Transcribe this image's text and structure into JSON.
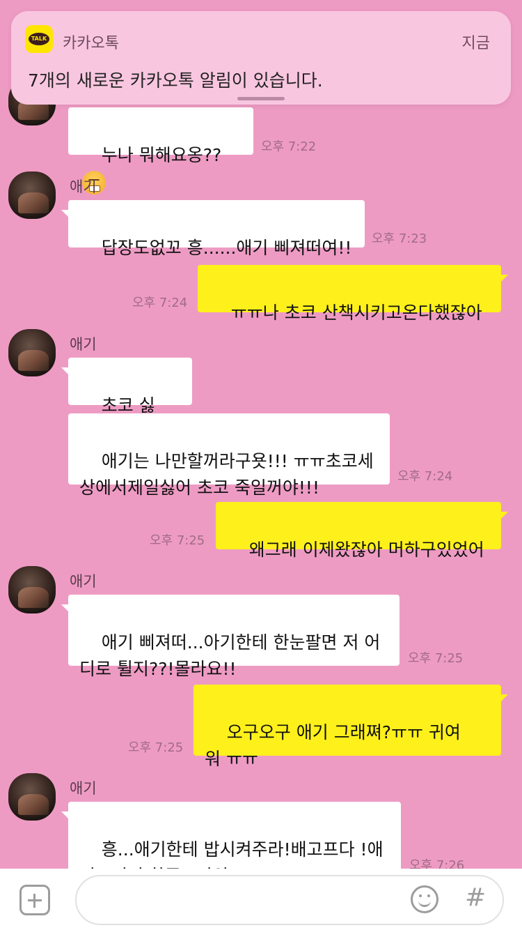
{
  "notification": {
    "app_name": "카카오톡",
    "time": "지금",
    "message": "7개의 새로운 카카오톡 알림이 있습니다.",
    "icon_label": "TALK"
  },
  "messages": [
    {
      "text": "누나 뭐해요옹??",
      "time": "오후 7:22"
    },
    {
      "sender": "애기",
      "text": "답장도없꼬 흥......애기 삐져떠여!!",
      "time": "오후 7:23"
    },
    {
      "text": "ㅠㅠ나 초코 산책시키고온다했잖아",
      "time": "오후 7:24"
    },
    {
      "sender": "애기",
      "text": "초코 싫어!!!!"
    },
    {
      "text": "애기는 나만할꺼라구욧!!! ㅠㅠ초코세\n상에서제일싫어 초코 죽일꺼야!!!",
      "time": "오후 7:24"
    },
    {
      "text": "왜그래 이제왔잖아 머하구있었어",
      "time": "오후 7:25"
    },
    {
      "sender": "애기",
      "text": "애기 삐져떠...아기한테 한눈팔면 저 어\n디로 튈지??!몰라요!!",
      "time": "오후 7:25"
    },
    {
      "text": "오구오구 애기 그래쪄?ㅠㅠ 귀여\n워 ㅠㅠ",
      "time": "오후 7:25"
    },
    {
      "sender": "애기",
      "text": "흥...애기한테 밥시켜주라!배고프다 !애\n기그러면 화푼드아앙!!",
      "time": "오후 7:26"
    }
  ],
  "input": {
    "placeholder": "",
    "hash_label": "#"
  },
  "colors": {
    "background": "#ee9bc4",
    "outgoing_bubble": "#fef01b",
    "incoming_bubble": "#ffffff",
    "notification_bg": "#f9c6e0"
  }
}
